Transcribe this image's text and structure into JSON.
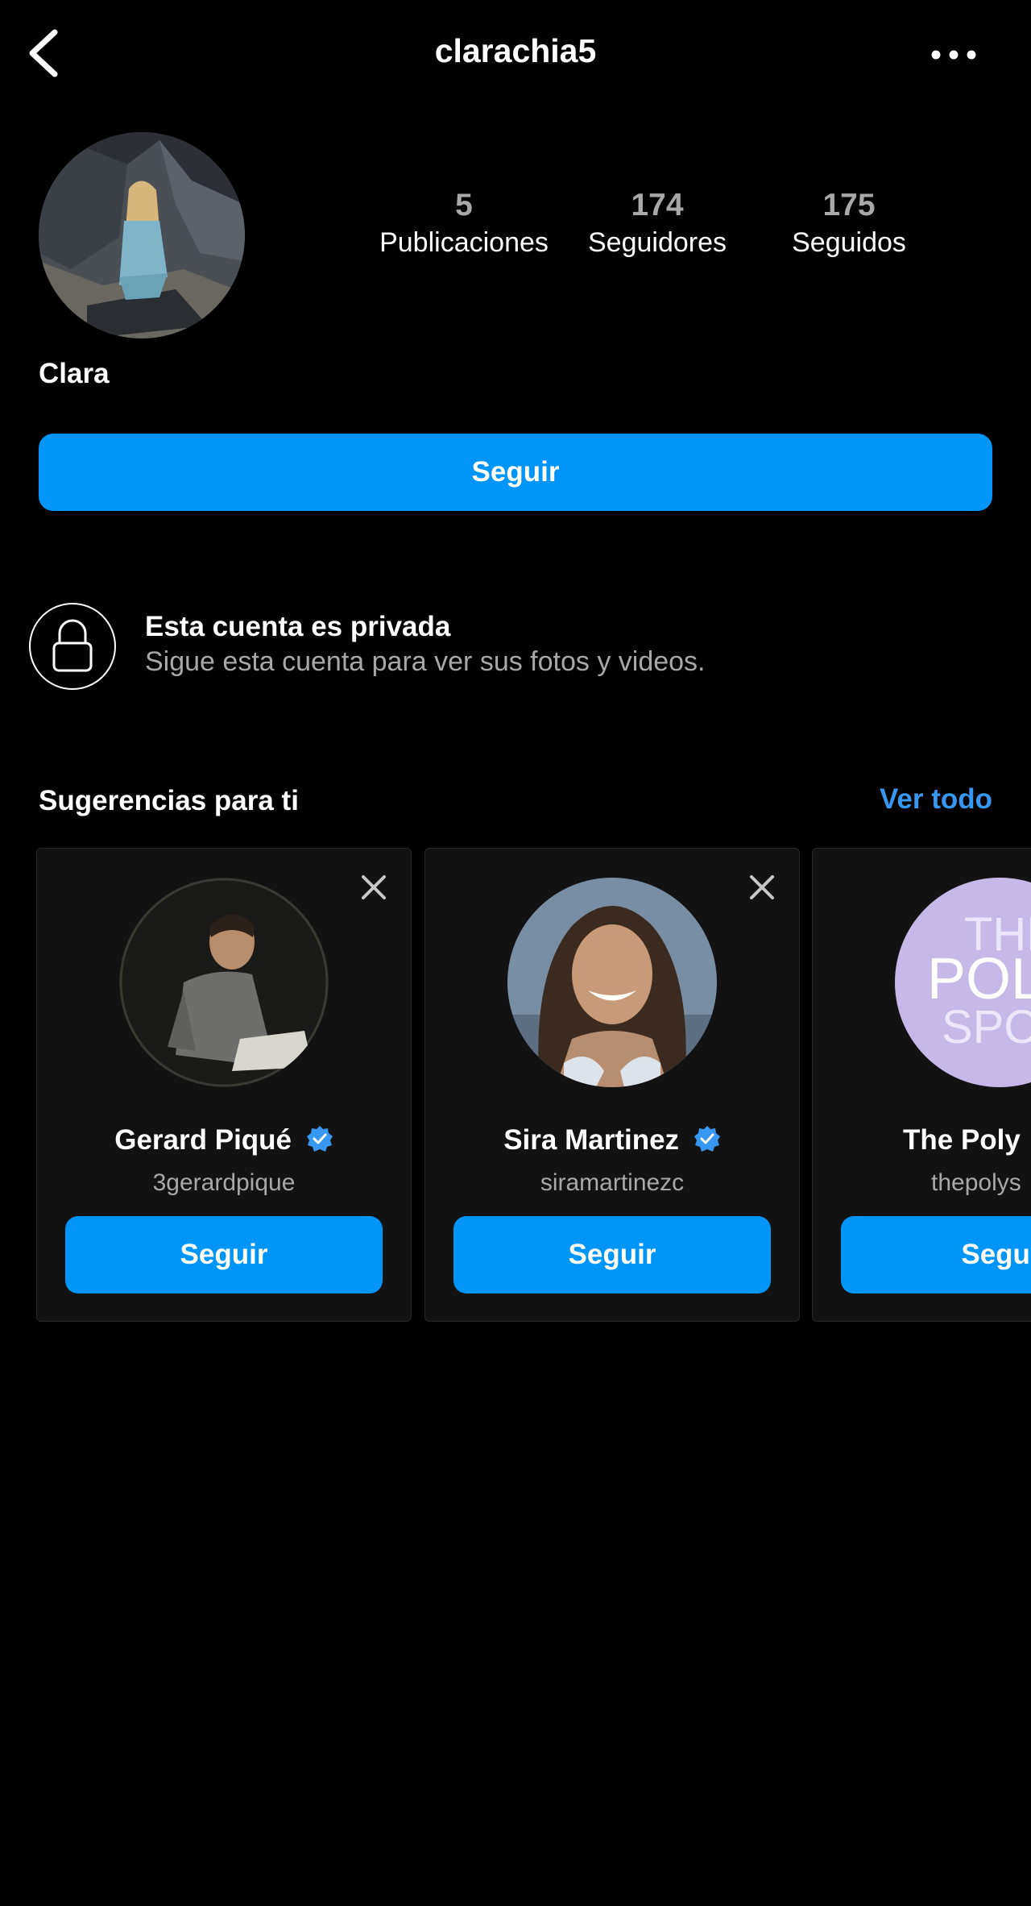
{
  "header": {
    "username": "clarachia5",
    "back_icon": "chevron-left-icon",
    "more_icon": "more-horizontal-icon"
  },
  "profile": {
    "display_name": "Clara",
    "stats": {
      "posts_value": "5",
      "posts_label": "Publicaciones",
      "followers_value": "174",
      "followers_label": "Seguidores",
      "following_value": "175",
      "following_label": "Seguidos"
    },
    "follow_label": "Seguir"
  },
  "private_notice": {
    "title": "Esta cuenta es privada",
    "subtitle": "Sigue esta cuenta para ver sus fotos y videos.",
    "icon": "lock-icon"
  },
  "suggestions": {
    "title": "Sugerencias para ti",
    "see_all_label": "Ver todo",
    "cards": [
      {
        "name": "Gerard Piqué",
        "handle": "3gerardpique",
        "verified": true,
        "follow_label": "Seguir"
      },
      {
        "name": "Sira Martinez",
        "handle": "siramartinezc",
        "verified": true,
        "follow_label": "Seguir"
      },
      {
        "name": "The Poly",
        "handle": "thepolys",
        "avatar_text": "THE POL SPO",
        "follow_label": "Segui"
      }
    ]
  },
  "colors": {
    "background": "#000000",
    "accent": "#0095f6",
    "link": "#3897f0",
    "secondary_text": "#a8a8a8",
    "card_bg": "#121212"
  }
}
